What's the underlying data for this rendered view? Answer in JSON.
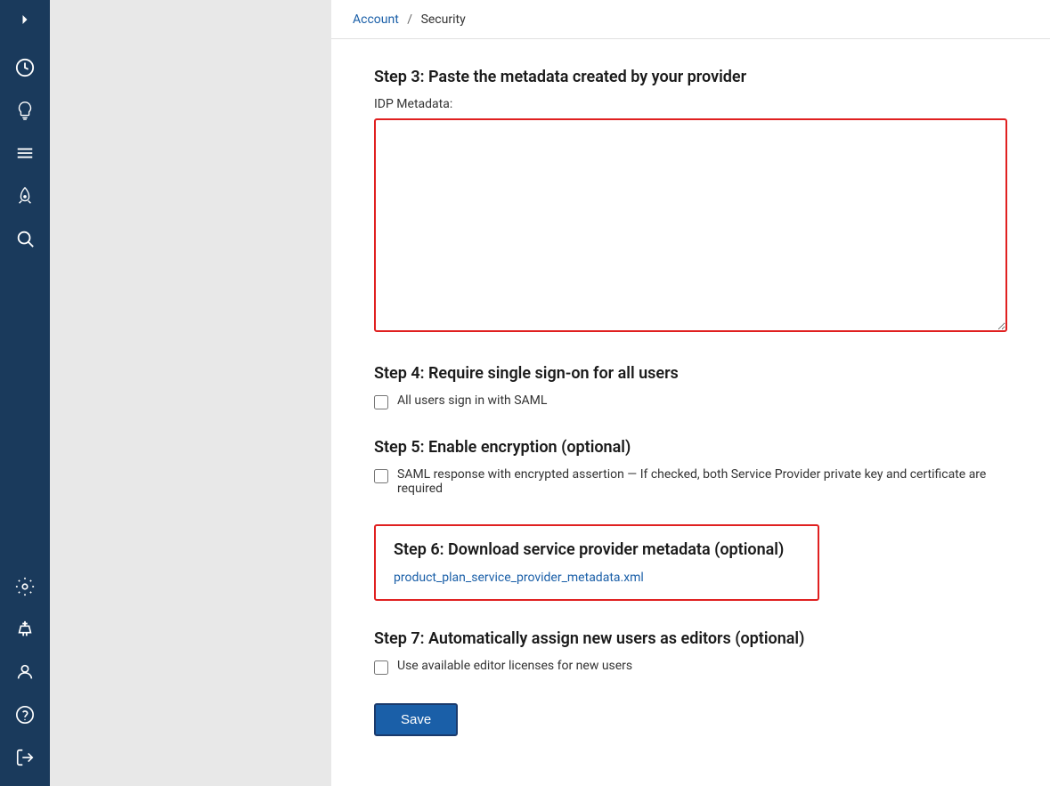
{
  "breadcrumb": {
    "account_label": "Account",
    "separator": "/",
    "security_label": "Security"
  },
  "sidebar": {
    "toggle_label": "Toggle sidebar",
    "items": [
      {
        "name": "dashboard",
        "label": "Dashboard"
      },
      {
        "name": "lightbulb",
        "label": "Ideas"
      },
      {
        "name": "menu",
        "label": "Menu"
      },
      {
        "name": "rocket",
        "label": "Launch"
      },
      {
        "name": "search",
        "label": "Search"
      }
    ],
    "bottom_items": [
      {
        "name": "settings",
        "label": "Settings"
      },
      {
        "name": "integrations",
        "label": "Integrations"
      },
      {
        "name": "users",
        "label": "Users"
      },
      {
        "name": "help",
        "label": "Help"
      },
      {
        "name": "logout",
        "label": "Logout"
      }
    ]
  },
  "steps": {
    "step3": {
      "title": "Step 3: Paste the metadata created by your provider",
      "idp_label": "IDP Metadata:",
      "textarea_value": "",
      "textarea_placeholder": ""
    },
    "step4": {
      "title": "Step 4: Require single sign-on for all users",
      "checkbox_label": "All users sign in with SAML",
      "checked": false
    },
    "step5": {
      "title": "Step 5: Enable encryption (optional)",
      "checkbox_label": "SAML response with encrypted assertion — If checked, both Service Provider private key and certificate are required",
      "checked": false
    },
    "step6": {
      "title": "Step 6: Download service provider metadata (optional)",
      "link_text": "product_plan_service_provider_metadata.xml",
      "link_href": "#"
    },
    "step7": {
      "title": "Step 7: Automatically assign new users as editors (optional)",
      "checkbox_label": "Use available editor licenses for new users",
      "checked": false
    }
  },
  "toolbar": {
    "save_label": "Save"
  }
}
